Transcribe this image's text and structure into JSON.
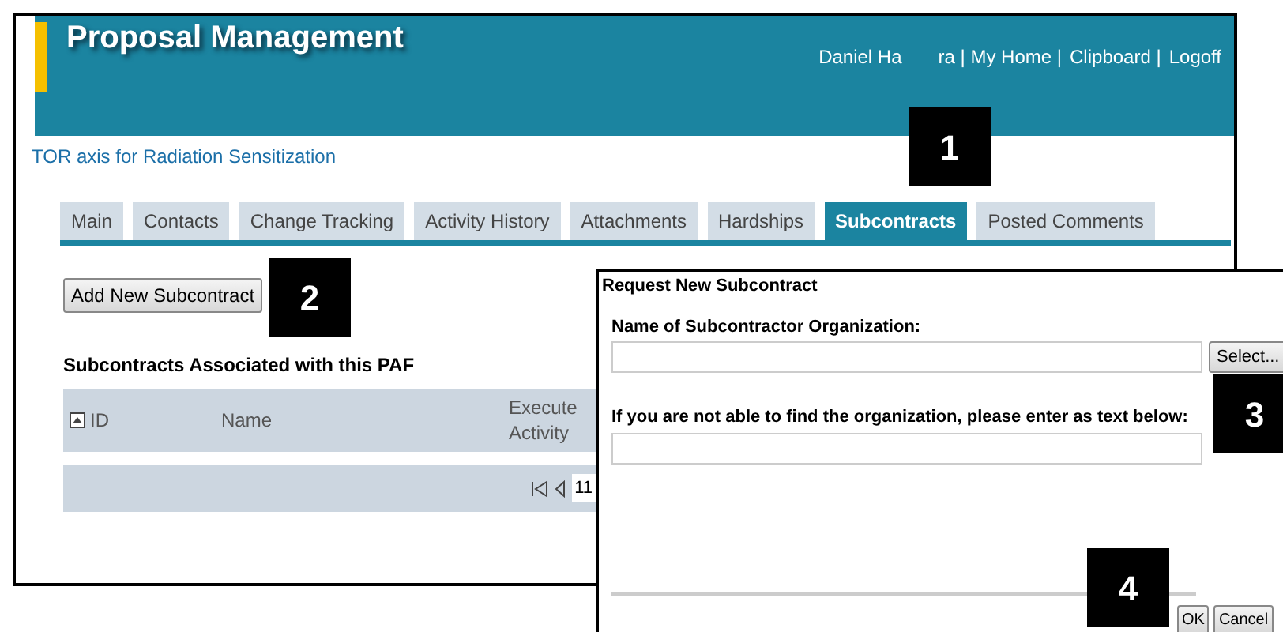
{
  "header": {
    "title": "Proposal Management",
    "links": [
      "Daniel Ha",
      "ra | My Home |",
      "Clipboard |",
      "Logoff"
    ]
  },
  "breadcrumb": "TOR axis for Radiation Sensitization",
  "tabs": [
    {
      "label": "Main",
      "selected": false
    },
    {
      "label": "Contacts",
      "selected": false
    },
    {
      "label": "Change Tracking",
      "selected": false
    },
    {
      "label": "Activity History",
      "selected": false
    },
    {
      "label": "Attachments",
      "selected": false
    },
    {
      "label": "Hardships",
      "selected": false
    },
    {
      "label": "Subcontracts",
      "selected": true
    },
    {
      "label": "Posted Comments",
      "selected": false
    }
  ],
  "add_button": "Add New Subcontract",
  "section_title": "Subcontracts Associated with this PAF",
  "table": {
    "columns": [
      "ID",
      "Name",
      "Execute Activity"
    ],
    "pager_page": "11"
  },
  "dialog": {
    "title": "Request New Subcontract",
    "org_label": "Name of Subcontractor Organization:",
    "select_button": "Select...",
    "text_label": "If you are not able to find the organization, please enter as text below:",
    "buttons": [
      "OK",
      "Cancel"
    ]
  },
  "callouts": [
    "1",
    "2",
    "3",
    "4"
  ]
}
